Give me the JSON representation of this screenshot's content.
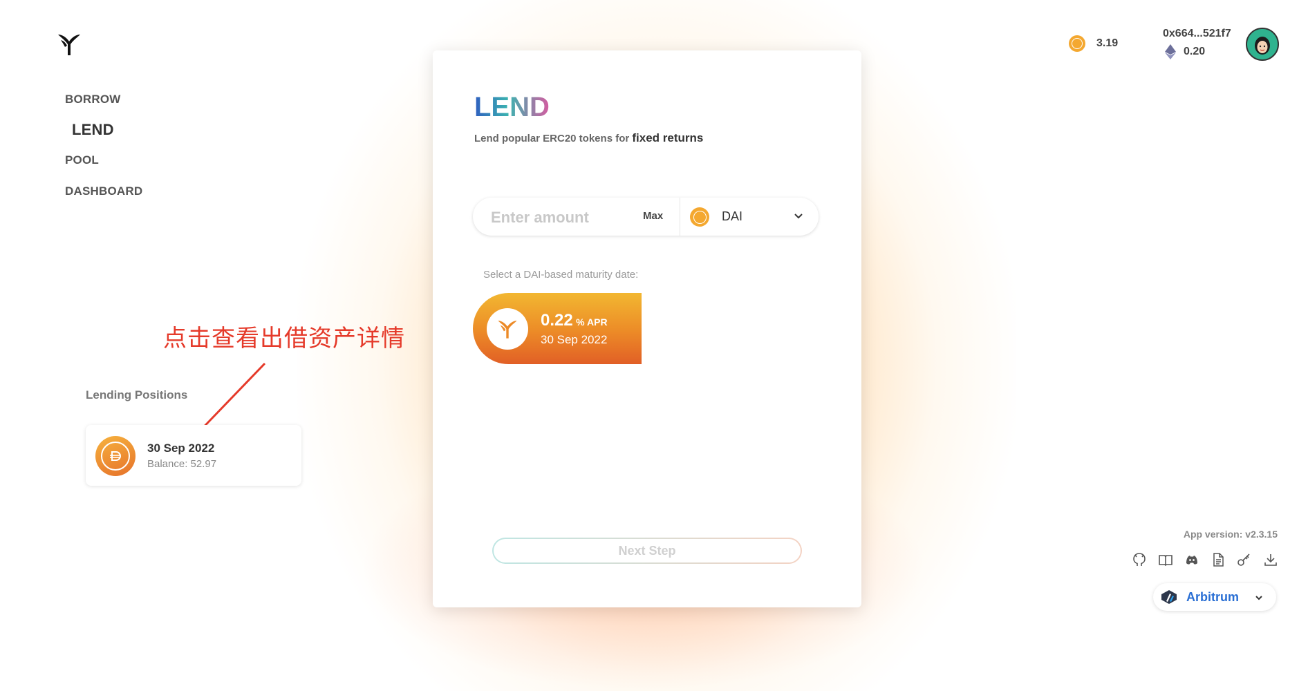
{
  "nav": {
    "items": [
      {
        "label": "BORROW",
        "active": false
      },
      {
        "label": "LEND",
        "active": true
      },
      {
        "label": "POOL",
        "active": false
      },
      {
        "label": "DASHBOARD",
        "active": false
      }
    ]
  },
  "annotation": {
    "text": "点击查看出借资产详情",
    "color": "#e53a2a"
  },
  "lending_positions": {
    "title": "Lending Positions",
    "items": [
      {
        "date": "30 Sep 2022",
        "balance_label": "Balance:",
        "balance_value": "52.97",
        "icon": "dai-coin-icon"
      }
    ]
  },
  "lend_card": {
    "title": "LEND",
    "subtitle_prefix": "Lend popular ERC20 tokens for",
    "subtitle_emphasis": "fixed returns",
    "amount_placeholder": "Enter amount",
    "amount_value": "",
    "max_label": "Max",
    "token": "DAI",
    "maturity_label": "Select a DAI-based maturity date:",
    "pools": [
      {
        "apr": "0.22",
        "apr_unit": "% APR",
        "date": "30 Sep 2022"
      }
    ],
    "next_label": "Next Step"
  },
  "header": {
    "token_balance": "3.19",
    "address": "0x664...521f7",
    "eth_balance": "0.20"
  },
  "footer": {
    "version": "App version: v2.3.15",
    "links": [
      "github-icon",
      "docs-book-icon",
      "discord-icon",
      "document-icon",
      "key-icon",
      "download-icon"
    ],
    "network": "Arbitrum"
  },
  "colors": {
    "accent_orange": "#ec8a27",
    "dai": "#f4a830",
    "network_blue": "#2a6fd4"
  }
}
